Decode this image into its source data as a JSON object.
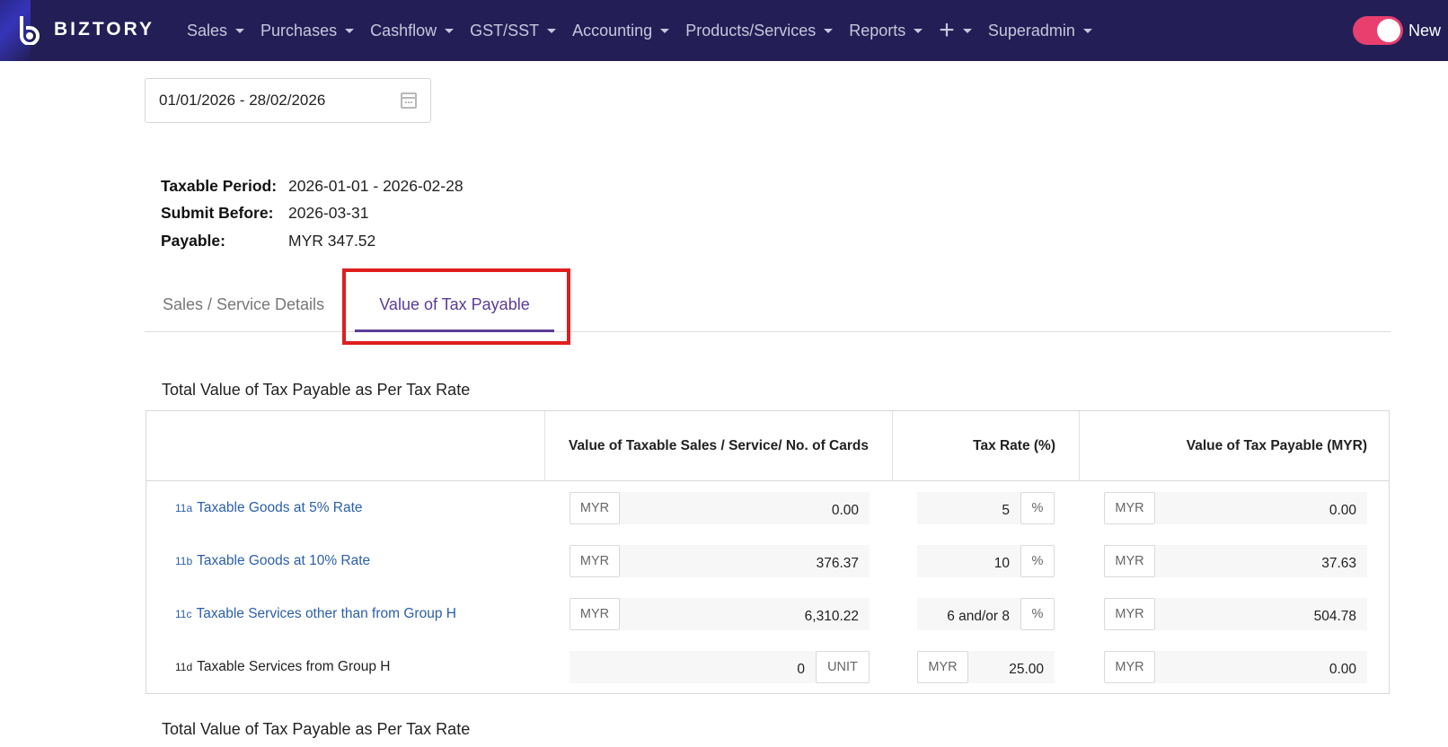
{
  "app": {
    "name": "BIZTORY"
  },
  "nav": {
    "items": [
      {
        "label": "Sales"
      },
      {
        "label": "Purchases"
      },
      {
        "label": "Cashflow"
      },
      {
        "label": "GST/SST"
      },
      {
        "label": "Accounting"
      },
      {
        "label": "Products/Services"
      },
      {
        "label": "Reports"
      }
    ],
    "plus_label": "+",
    "user_label": "Superadmin",
    "toggle_label": "New",
    "toggle_on": true
  },
  "date_range": {
    "value": "01/01/2026 - 28/02/2026"
  },
  "summary": {
    "taxable_period_label": "Taxable Period:",
    "taxable_period_value": "2026-01-01 - 2026-02-28",
    "submit_before_label": "Submit Before:",
    "submit_before_value": "2026-03-31",
    "payable_label": "Payable:",
    "payable_value": "MYR 347.52"
  },
  "tabs": [
    {
      "label": "Sales / Service Details",
      "active": false
    },
    {
      "label": "Value of Tax Payable",
      "active": true
    }
  ],
  "section": {
    "title": "Total Value of Tax Payable as Per Tax Rate"
  },
  "table": {
    "headers": [
      "",
      "Value of Taxable Sales / Service/ No. of Cards",
      "Tax Rate (%)",
      "Value of Tax Payable (MYR)"
    ],
    "rows": [
      {
        "code": "11a",
        "label": "Taxable Goods at 5% Rate",
        "is_link": true,
        "value_prefix": "MYR",
        "value": "0.00",
        "rate": "5",
        "rate_suffix": "%",
        "payable_prefix": "MYR",
        "payable": "0.00"
      },
      {
        "code": "11b",
        "label": "Taxable Goods at 10% Rate",
        "is_link": true,
        "value_prefix": "MYR",
        "value": "376.37",
        "rate": "10",
        "rate_suffix": "%",
        "payable_prefix": "MYR",
        "payable": "37.63"
      },
      {
        "code": "11c",
        "label": "Taxable Services other than from Group H",
        "is_link": true,
        "value_prefix": "MYR",
        "value": "6,310.22",
        "rate": "6 and/or 8",
        "rate_suffix": "%",
        "payable_prefix": "MYR",
        "payable": "504.78"
      },
      {
        "code": "11d",
        "label": "Taxable Services from Group H",
        "is_link": false,
        "value": "0",
        "value_suffix": "UNIT",
        "rate_prefix": "MYR",
        "rate": "25.00",
        "payable_prefix": "MYR",
        "payable": "0.00"
      }
    ]
  },
  "section2": {
    "title": "Total Value of Tax Payable as Per Tax Rate"
  },
  "colors": {
    "nav_bg": "#231e55",
    "accent": "#5b3c98",
    "toggle": "#e83f6f",
    "link": "#2a5fa8",
    "highlight": "#e01e1e"
  }
}
